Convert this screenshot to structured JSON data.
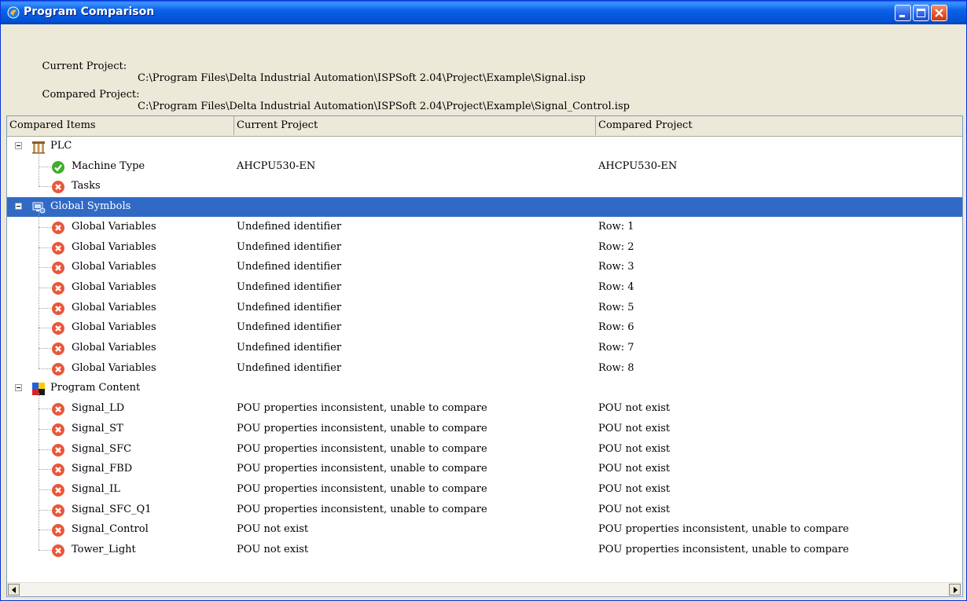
{
  "window": {
    "title": "Program Comparison",
    "buttons": {
      "minimize": "minimize-icon",
      "maximize": "maximize-icon",
      "close": "close-icon"
    }
  },
  "projects": {
    "current_label": "Current Project:",
    "current_path": "C:\\Program Files\\Delta Industrial Automation\\ISPSoft 2.04\\Project\\Example\\Signal.isp",
    "compared_label": "Compared Project:",
    "compared_path": "C:\\Program Files\\Delta Industrial Automation\\ISPSoft 2.04\\Project\\Example\\Signal_Control.isp"
  },
  "table": {
    "columns": [
      "Compared Items",
      "Current Project",
      "Compared Project"
    ],
    "groups": [
      {
        "label": "PLC",
        "icon": "plc-icon",
        "items": [
          {
            "label": "Machine Type",
            "status": "ok",
            "current": "AHCPU530-EN",
            "compared": "AHCPU530-EN"
          },
          {
            "label": "Tasks",
            "status": "error",
            "current": "",
            "compared": ""
          }
        ]
      },
      {
        "label": "Global Symbols",
        "icon": "global-symbols-icon",
        "selected": true,
        "items": [
          {
            "label": "Global Variables",
            "status": "error",
            "current": "Undefined identifier",
            "compared": "Row: 1"
          },
          {
            "label": "Global Variables",
            "status": "error",
            "current": "Undefined identifier",
            "compared": "Row: 2"
          },
          {
            "label": "Global Variables",
            "status": "error",
            "current": "Undefined identifier",
            "compared": "Row: 3"
          },
          {
            "label": "Global Variables",
            "status": "error",
            "current": "Undefined identifier",
            "compared": "Row: 4"
          },
          {
            "label": "Global Variables",
            "status": "error",
            "current": "Undefined identifier",
            "compared": "Row: 5"
          },
          {
            "label": "Global Variables",
            "status": "error",
            "current": "Undefined identifier",
            "compared": "Row: 6"
          },
          {
            "label": "Global Variables",
            "status": "error",
            "current": "Undefined identifier",
            "compared": "Row: 7"
          },
          {
            "label": "Global Variables",
            "status": "error",
            "current": "Undefined identifier",
            "compared": "Row: 8"
          }
        ]
      },
      {
        "label": "Program Content",
        "icon": "program-content-icon",
        "items": [
          {
            "label": "Signal_LD",
            "status": "error",
            "current": "POU properties inconsistent, unable to compare",
            "compared": "POU not exist"
          },
          {
            "label": "Signal_ST",
            "status": "error",
            "current": "POU properties inconsistent, unable to compare",
            "compared": "POU not exist"
          },
          {
            "label": "Signal_SFC",
            "status": "error",
            "current": "POU properties inconsistent, unable to compare",
            "compared": "POU not exist"
          },
          {
            "label": "Signal_FBD",
            "status": "error",
            "current": "POU properties inconsistent, unable to compare",
            "compared": "POU not exist"
          },
          {
            "label": "Signal_IL",
            "status": "error",
            "current": "POU properties inconsistent, unable to compare",
            "compared": "POU not exist"
          },
          {
            "label": "Signal_SFC_Q1",
            "status": "error",
            "current": "POU properties inconsistent, unable to compare",
            "compared": "POU not exist"
          },
          {
            "label": "Signal_Control",
            "status": "error",
            "current": "POU not exist",
            "compared": "POU properties inconsistent, unable to compare"
          },
          {
            "label": "Tower_Light",
            "status": "error",
            "current": "POU not exist",
            "compared": "POU properties inconsistent, unable to compare"
          }
        ]
      }
    ]
  },
  "colors": {
    "selection": "#316ac5",
    "ok": "#3fae29",
    "error": "#e8573a",
    "titlebar": "#0352d6"
  }
}
